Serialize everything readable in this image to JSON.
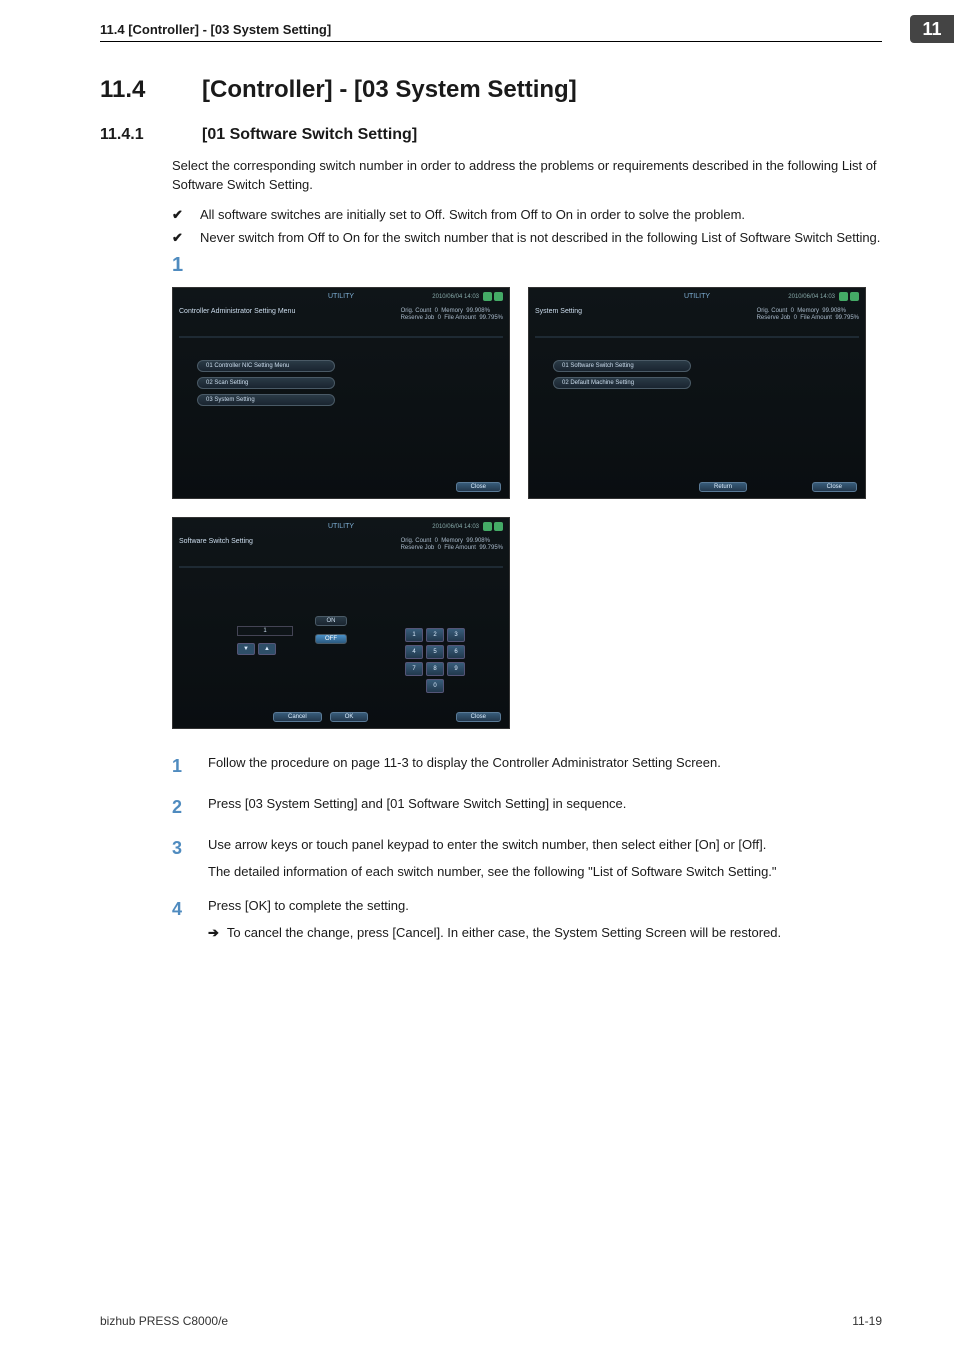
{
  "running_head": "11.4    [Controller] - [03 System Setting]",
  "chapter_number": "11",
  "section": {
    "number": "11.4",
    "title": "[Controller] - [03 System Setting]"
  },
  "subsection": {
    "number": "11.4.1",
    "title": "[01 Software Switch Setting]",
    "intro": "Select the corresponding switch number in order to address the problems or requirements described in the following List of Software Switch Setting.",
    "checks": [
      "All software switches are initially set to Off. Switch from Off to On in order to solve the problem.",
      "Never switch from Off to On for the switch number that is not described in the following List of Software Switch Setting."
    ],
    "big_step": "1"
  },
  "screenshots": {
    "utility_label": "UTILITY",
    "datetime": "2010/06/04 14:03",
    "stats_l1": "Orig. Count",
    "stats_l2": "Reserve Job",
    "stats_v1": "0",
    "stats_v2": "0",
    "stats_m1": "Memory",
    "stats_m2": "File Amount",
    "stats_m1v": "99.908%",
    "stats_m2v": "99.795%",
    "s1": {
      "title": "Controller Administrator Setting Menu",
      "items": [
        "01 Controller NIC Setting Menu",
        "02 Scan Setting",
        "03 System Setting"
      ],
      "close": "Close"
    },
    "s2": {
      "title": "System Setting",
      "items": [
        "01 Software Switch Setting",
        "02 Default Machine Setting"
      ],
      "return": "Return",
      "close": "Close"
    },
    "s3": {
      "title": "Software Switch Setting",
      "no_value": "1",
      "on": "ON",
      "off": "OFF",
      "keys": [
        "1",
        "2",
        "3",
        "4",
        "5",
        "6",
        "7",
        "8",
        "9",
        "0"
      ],
      "cancel": "Cancel",
      "ok": "OK",
      "close": "Close"
    }
  },
  "steps": [
    {
      "n": "1",
      "text": "Follow the procedure on page 11-3 to display the Controller Administrator Setting Screen."
    },
    {
      "n": "2",
      "text": "Press [03 System Setting] and [01 Software Switch Setting] in sequence."
    },
    {
      "n": "3",
      "text": "Use arrow keys or touch panel keypad to enter the switch number, then select either [On] or [Off].",
      "para": "The detailed information of each switch number, see the following \"List of Software Switch Setting.\""
    },
    {
      "n": "4",
      "text": "Press [OK] to complete the setting.",
      "arrow": "To cancel the change, press [Cancel]. In either case, the System Setting Screen will be restored."
    }
  ],
  "footer": {
    "left": "bizhub PRESS C8000/e",
    "right": "11-19"
  }
}
